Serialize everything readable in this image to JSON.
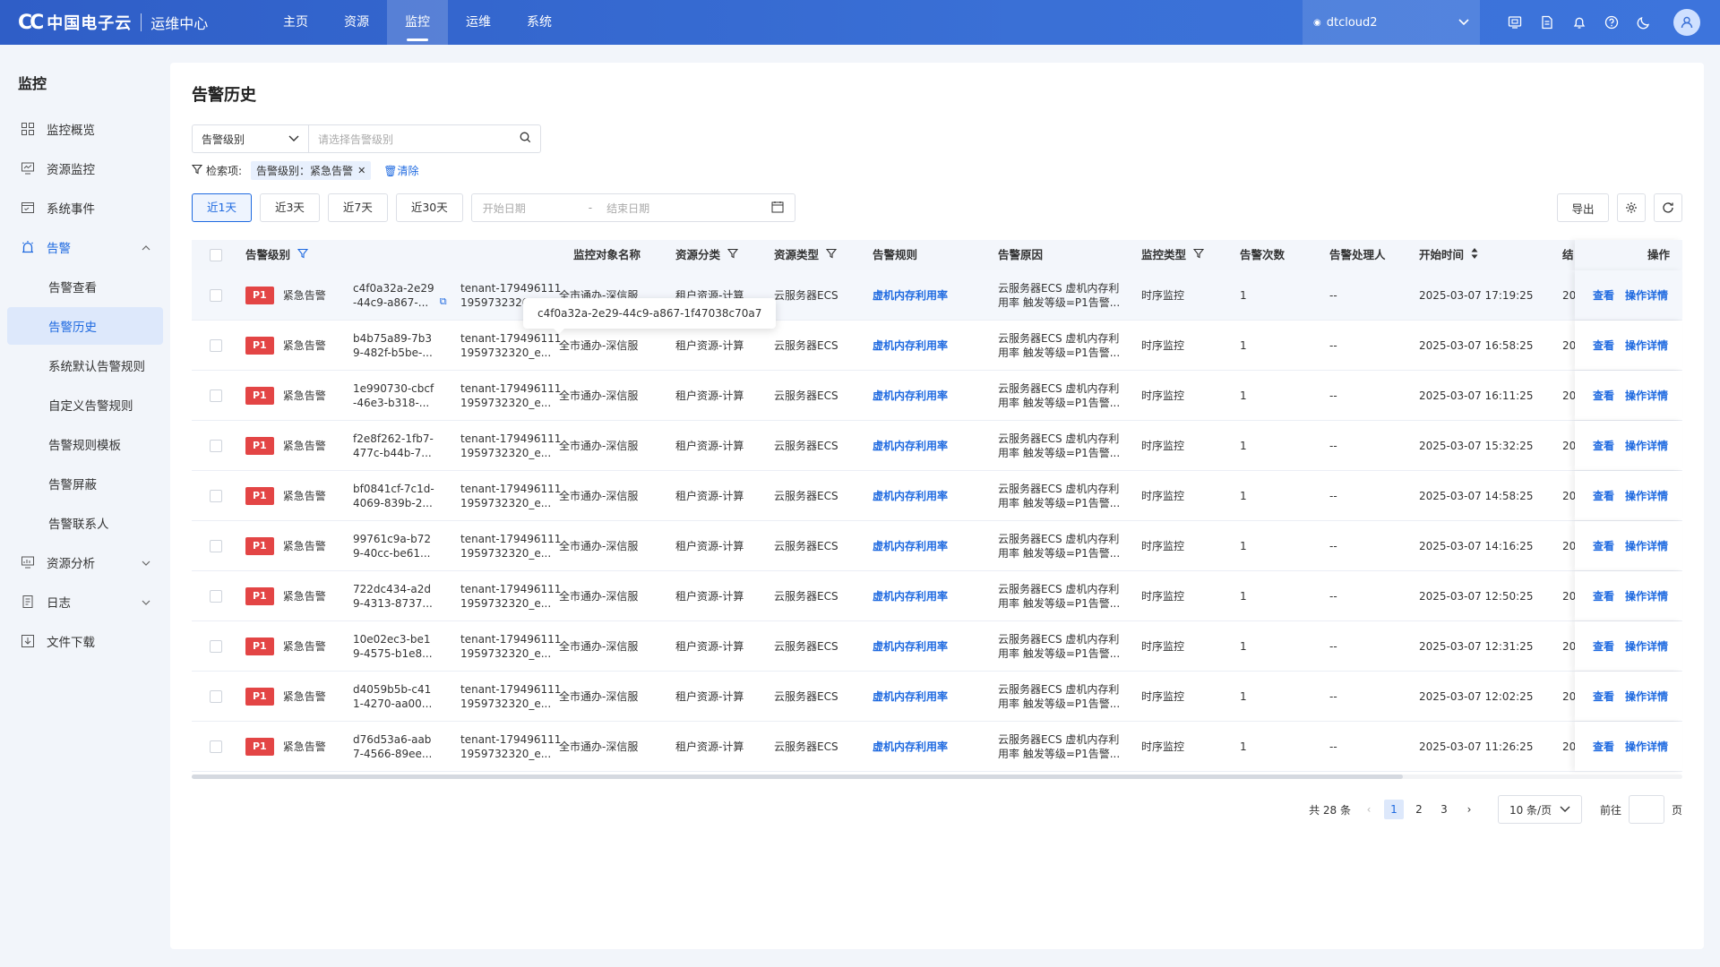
{
  "header": {
    "logo_mark": "CC",
    "logo_text": "中国电子云",
    "logo_sub": "运维中心",
    "nav": [
      {
        "label": "主页"
      },
      {
        "label": "资源"
      },
      {
        "label": "监控",
        "active": true
      },
      {
        "label": "运维"
      },
      {
        "label": "系统"
      }
    ],
    "tenant": "dtcloud2"
  },
  "sidebar": {
    "title": "监控",
    "items": [
      {
        "label": "监控概览",
        "icon": "grid-icon"
      },
      {
        "label": "资源监控",
        "icon": "monitor-icon"
      },
      {
        "label": "系统事件",
        "icon": "event-icon"
      },
      {
        "label": "告警",
        "icon": "alarm-icon",
        "expanded": true
      },
      {
        "label": "告警查看"
      },
      {
        "label": "告警历史",
        "active": true
      },
      {
        "label": "系统默认告警规则"
      },
      {
        "label": "自定义告警规则"
      },
      {
        "label": "告警规则模板"
      },
      {
        "label": "告警屏蔽"
      },
      {
        "label": "告警联系人"
      },
      {
        "label": "资源分析",
        "icon": "analysis-icon"
      },
      {
        "label": "日志",
        "icon": "log-icon"
      },
      {
        "label": "文件下载",
        "icon": "download-icon"
      }
    ]
  },
  "main": {
    "title": "告警历史",
    "filter_select": "告警级别",
    "filter_placeholder": "请选择告警级别",
    "cond_label": "检索项:",
    "cond_tag": "告警级别：紧急告警",
    "clear_label": "清除",
    "ranges": [
      "近1天",
      "近3天",
      "近7天",
      "近30天"
    ],
    "active_range": "近1天",
    "start_placeholder": "开始日期",
    "date_sep": "-",
    "end_placeholder": "结束日期",
    "export_label": "导出",
    "tooltip": "c4f0a32a-2e29-44c9-a867-1f47038c70a7"
  },
  "table": {
    "headers": {
      "level": "告警级别",
      "id": "",
      "tenant": "",
      "obj": "监控对象名称",
      "cat": "资源分类",
      "type": "资源类型",
      "rule": "告警规则",
      "reason": "告警原因",
      "mtype": "监控类型",
      "count": "告警次数",
      "handler": "告警处理人",
      "start": "开始时间",
      "end": "结",
      "op": "操作"
    },
    "rows": [
      {
        "level": "P1",
        "level_text": "紧急告警",
        "id": "c4f0a32a-2e29\n-44c9-a867-...",
        "tenant": "tenant-179496111\n1959732320_e...",
        "obj": "全市通办-深信服",
        "cat": "租户资源-计算",
        "type": "云服务器ECS",
        "rule": "虚机内存利用率",
        "reason": "云服务器ECS 虚机内存利\n用率 触发等级=P1告警...",
        "mtype": "时序监控",
        "count": "1",
        "handler": "--",
        "start": "2025-03-07 17:19:25",
        "end": "20",
        "view": "查看",
        "detail": "操作详情"
      },
      {
        "level": "P1",
        "level_text": "紧急告警",
        "id": "b4b75a89-7b3\n9-482f-b5be-...",
        "tenant": "tenant-179496111\n1959732320_e...",
        "obj": "全市通办-深信服",
        "cat": "租户资源-计算",
        "type": "云服务器ECS",
        "rule": "虚机内存利用率",
        "reason": "云服务器ECS 虚机内存利\n用率 触发等级=P1告警...",
        "mtype": "时序监控",
        "count": "1",
        "handler": "--",
        "start": "2025-03-07 16:58:25",
        "end": "20",
        "view": "查看",
        "detail": "操作详情"
      },
      {
        "level": "P1",
        "level_text": "紧急告警",
        "id": "1e990730-cbcf\n-46e3-b318-...",
        "tenant": "tenant-179496111\n1959732320_e...",
        "obj": "全市通办-深信服",
        "cat": "租户资源-计算",
        "type": "云服务器ECS",
        "rule": "虚机内存利用率",
        "reason": "云服务器ECS 虚机内存利\n用率 触发等级=P1告警...",
        "mtype": "时序监控",
        "count": "1",
        "handler": "--",
        "start": "2025-03-07 16:11:25",
        "end": "20",
        "view": "查看",
        "detail": "操作详情"
      },
      {
        "level": "P1",
        "level_text": "紧急告警",
        "id": "f2e8f262-1fb7-\n477c-b44b-7...",
        "tenant": "tenant-179496111\n1959732320_e...",
        "obj": "全市通办-深信服",
        "cat": "租户资源-计算",
        "type": "云服务器ECS",
        "rule": "虚机内存利用率",
        "reason": "云服务器ECS 虚机内存利\n用率 触发等级=P1告警...",
        "mtype": "时序监控",
        "count": "1",
        "handler": "--",
        "start": "2025-03-07 15:32:25",
        "end": "20",
        "view": "查看",
        "detail": "操作详情"
      },
      {
        "level": "P1",
        "level_text": "紧急告警",
        "id": "bf0841cf-7c1d-\n4069-839b-2...",
        "tenant": "tenant-179496111\n1959732320_e...",
        "obj": "全市通办-深信服",
        "cat": "租户资源-计算",
        "type": "云服务器ECS",
        "rule": "虚机内存利用率",
        "reason": "云服务器ECS 虚机内存利\n用率 触发等级=P1告警...",
        "mtype": "时序监控",
        "count": "1",
        "handler": "--",
        "start": "2025-03-07 14:58:25",
        "end": "20",
        "view": "查看",
        "detail": "操作详情"
      },
      {
        "level": "P1",
        "level_text": "紧急告警",
        "id": "99761c9a-b72\n9-40cc-be61...",
        "tenant": "tenant-179496111\n1959732320_e...",
        "obj": "全市通办-深信服",
        "cat": "租户资源-计算",
        "type": "云服务器ECS",
        "rule": "虚机内存利用率",
        "reason": "云服务器ECS 虚机内存利\n用率 触发等级=P1告警...",
        "mtype": "时序监控",
        "count": "1",
        "handler": "--",
        "start": "2025-03-07 14:16:25",
        "end": "20",
        "view": "查看",
        "detail": "操作详情"
      },
      {
        "level": "P1",
        "level_text": "紧急告警",
        "id": "722dc434-a2d\n9-4313-8737...",
        "tenant": "tenant-179496111\n1959732320_e...",
        "obj": "全市通办-深信服",
        "cat": "租户资源-计算",
        "type": "云服务器ECS",
        "rule": "虚机内存利用率",
        "reason": "云服务器ECS 虚机内存利\n用率 触发等级=P1告警...",
        "mtype": "时序监控",
        "count": "1",
        "handler": "--",
        "start": "2025-03-07 12:50:25",
        "end": "20",
        "view": "查看",
        "detail": "操作详情"
      },
      {
        "level": "P1",
        "level_text": "紧急告警",
        "id": "10e02ec3-be1\n9-4575-b1e8...",
        "tenant": "tenant-179496111\n1959732320_e...",
        "obj": "全市通办-深信服",
        "cat": "租户资源-计算",
        "type": "云服务器ECS",
        "rule": "虚机内存利用率",
        "reason": "云服务器ECS 虚机内存利\n用率 触发等级=P1告警...",
        "mtype": "时序监控",
        "count": "1",
        "handler": "--",
        "start": "2025-03-07 12:31:25",
        "end": "20",
        "view": "查看",
        "detail": "操作详情"
      },
      {
        "level": "P1",
        "level_text": "紧急告警",
        "id": "d4059b5b-c41\n1-4270-aa00...",
        "tenant": "tenant-179496111\n1959732320_e...",
        "obj": "全市通办-深信服",
        "cat": "租户资源-计算",
        "type": "云服务器ECS",
        "rule": "虚机内存利用率",
        "reason": "云服务器ECS 虚机内存利\n用率 触发等级=P1告警...",
        "mtype": "时序监控",
        "count": "1",
        "handler": "--",
        "start": "2025-03-07 12:02:25",
        "end": "20",
        "view": "查看",
        "detail": "操作详情"
      },
      {
        "level": "P1",
        "level_text": "紧急告警",
        "id": "d76d53a6-aab\n7-4566-89ee...",
        "tenant": "tenant-179496111\n1959732320_e...",
        "obj": "全市通办-深信服",
        "cat": "租户资源-计算",
        "type": "云服务器ECS",
        "rule": "虚机内存利用率",
        "reason": "云服务器ECS 虚机内存利\n用率 触发等级=P1告警...",
        "mtype": "时序监控",
        "count": "1",
        "handler": "--",
        "start": "2025-03-07 11:26:25",
        "end": "20",
        "view": "查看",
        "detail": "操作详情"
      }
    ]
  },
  "pagination": {
    "total": "共 28 条",
    "pages": [
      "1",
      "2",
      "3"
    ],
    "current": "1",
    "page_size": "10 条/页",
    "goto": "前往",
    "page_unit": "页"
  },
  "colors": {
    "accent": "#1f6ae0",
    "danger": "#e34545",
    "header": "#3a70d6"
  }
}
